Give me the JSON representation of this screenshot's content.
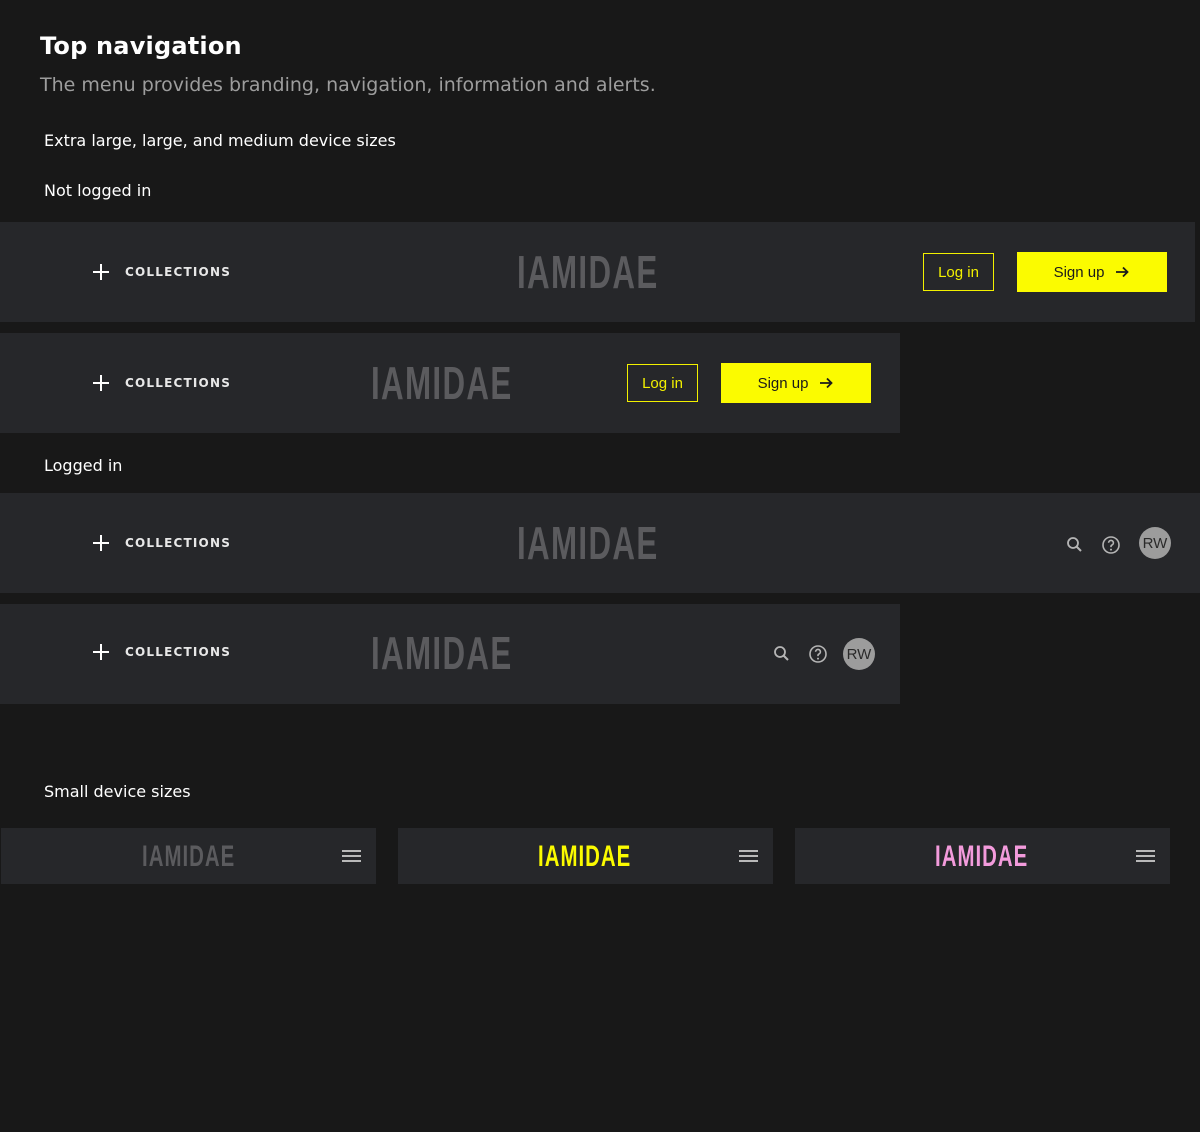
{
  "header": {
    "title": "Top navigation",
    "subtitle": "The menu provides branding, navigation, information and alerts."
  },
  "sections": {
    "large_devices": "Extra large, large, and medium device sizes",
    "not_logged_in": "Not logged in",
    "logged_in": "Logged in",
    "small_devices": "Small device sizes"
  },
  "nav": {
    "collections_label": "COLLECTIONS",
    "logo_text": "IAMIDAE",
    "login_label": "Log in",
    "signup_label": "Sign up",
    "avatar_initials": "RW"
  },
  "small_nav": {
    "logo_text": "IAMIDAE",
    "variants": [
      {
        "logo_color": "#5b5b5e"
      },
      {
        "logo_color": "#fbfb00"
      },
      {
        "logo_color": "#f39bdc"
      }
    ]
  },
  "colors": {
    "background": "#181818",
    "navbar": "#26272a",
    "accent_yellow": "#fbfb00",
    "accent_pink": "#f39bdc",
    "logo_grey": "#5b5b5e"
  }
}
